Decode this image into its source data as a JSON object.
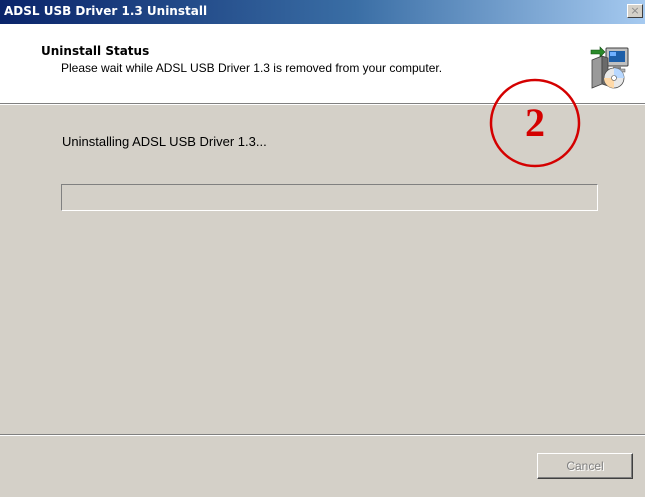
{
  "window": {
    "title": "ADSL USB Driver 1.3 Uninstall",
    "close_label": "×"
  },
  "header": {
    "title": "Uninstall Status",
    "subtitle": "Please wait while ADSL USB Driver 1.3 is removed from your computer.",
    "icon": "installer-computer-disc-icon"
  },
  "main": {
    "status_text": "Uninstalling ADSL USB Driver 1.3...",
    "progress_fraction": 0
  },
  "footer": {
    "cancel_label": "Cancel",
    "cancel_enabled": false
  },
  "annotation": {
    "number": "2",
    "color": "#d40000"
  },
  "colors": {
    "title_bar_start": "#0a246a",
    "title_bar_end": "#a6caf0",
    "dialog_face": "#d4d0c8"
  }
}
